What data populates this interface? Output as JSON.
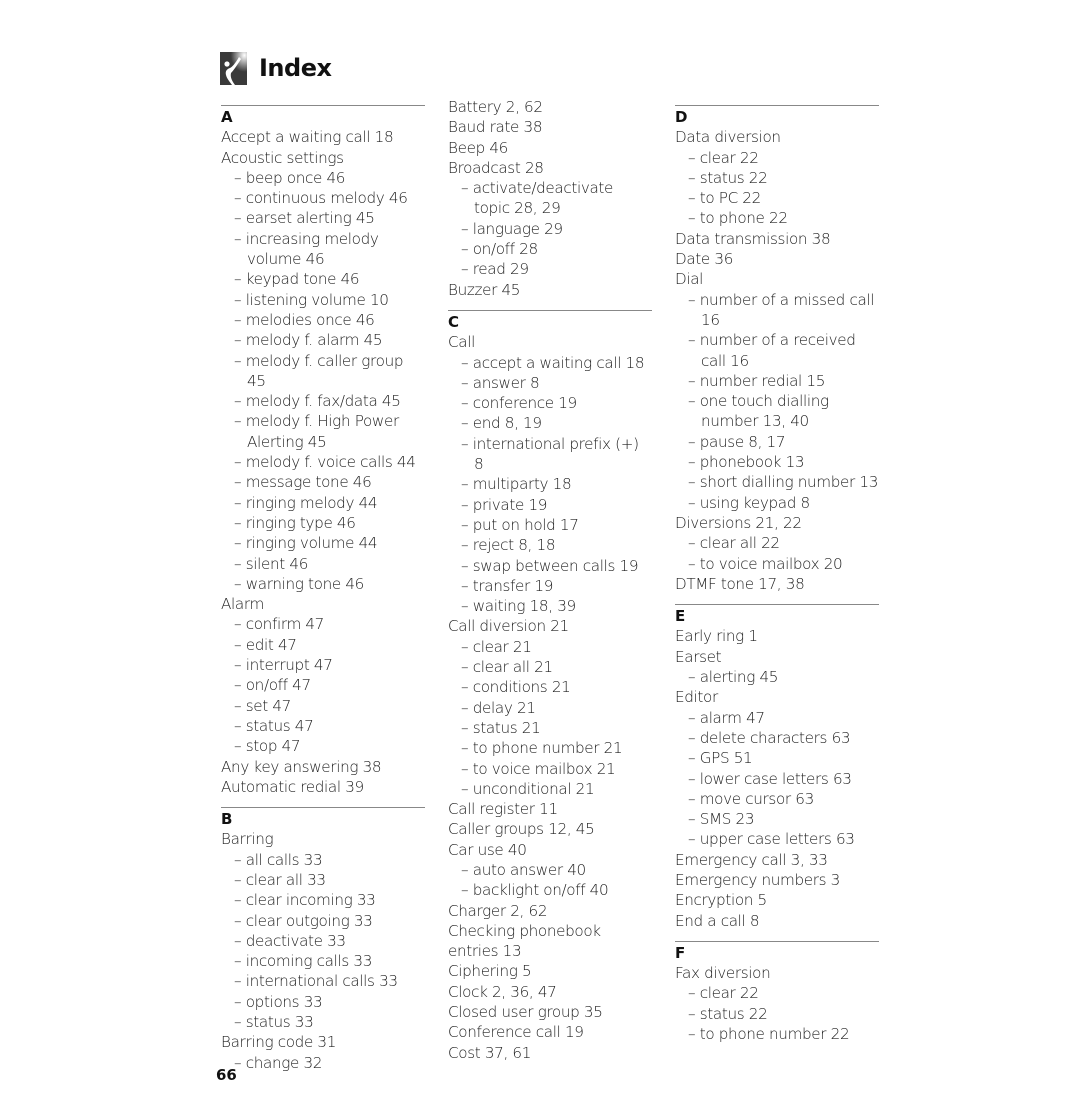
{
  "header": {
    "title": "Index",
    "icon": "person-with-raised-arm-logo"
  },
  "page_number": "66",
  "columns": [
    {
      "sections": [
        {
          "letter": "A",
          "separator": true,
          "entries": [
            {
              "text": "Accept a waiting call 18",
              "level": 0
            },
            {
              "text": "Acoustic settings",
              "level": 0
            },
            {
              "text": "beep once 46",
              "level": 1
            },
            {
              "text": "continuous melody 46",
              "level": 1
            },
            {
              "text": "earset alerting 45",
              "level": 1
            },
            {
              "text": "increasing melody volume 46",
              "level": 1
            },
            {
              "text": "keypad tone 46",
              "level": 1
            },
            {
              "text": "listening volume 10",
              "level": 1
            },
            {
              "text": "melodies once 46",
              "level": 1
            },
            {
              "text": "melody f. alarm 45",
              "level": 1
            },
            {
              "text": "melody f. caller group 45",
              "level": 1
            },
            {
              "text": "melody f. fax/data 45",
              "level": 1
            },
            {
              "text": "melody f. High Power Alerting 45",
              "level": 1
            },
            {
              "text": "melody f. voice calls 44",
              "level": 1
            },
            {
              "text": "message tone 46",
              "level": 1
            },
            {
              "text": "ringing melody 44",
              "level": 1
            },
            {
              "text": "ringing type 46",
              "level": 1
            },
            {
              "text": "ringing volume 44",
              "level": 1
            },
            {
              "text": "silent 46",
              "level": 1
            },
            {
              "text": "warning tone 46",
              "level": 1
            },
            {
              "text": "Alarm",
              "level": 0
            },
            {
              "text": "confirm 47",
              "level": 1
            },
            {
              "text": "edit 47",
              "level": 1
            },
            {
              "text": "interrupt 47",
              "level": 1
            },
            {
              "text": "on/off 47",
              "level": 1
            },
            {
              "text": "set 47",
              "level": 1
            },
            {
              "text": "status 47",
              "level": 1
            },
            {
              "text": "stop 47",
              "level": 1
            },
            {
              "text": "Any key answering 38",
              "level": 0
            },
            {
              "text": "Automatic redial 39",
              "level": 0
            }
          ]
        },
        {
          "letter": "B",
          "separator": true,
          "entries": [
            {
              "text": "Barring",
              "level": 0
            },
            {
              "text": "all calls 33",
              "level": 1
            },
            {
              "text": "clear all 33",
              "level": 1
            },
            {
              "text": "clear incoming 33",
              "level": 1
            },
            {
              "text": "clear outgoing 33",
              "level": 1
            },
            {
              "text": "deactivate 33",
              "level": 1
            },
            {
              "text": "incoming calls 33",
              "level": 1
            },
            {
              "text": "international calls 33",
              "level": 1
            },
            {
              "text": "options 33",
              "level": 1
            },
            {
              "text": "status 33",
              "level": 1
            },
            {
              "text": "Barring code 31",
              "level": 0
            },
            {
              "text": "change 32",
              "level": 1
            }
          ]
        }
      ]
    },
    {
      "sections": [
        {
          "letter": "",
          "separator": false,
          "entries": [
            {
              "text": "Battery 2, 62",
              "level": 0
            },
            {
              "text": "Baud rate 38",
              "level": 0
            },
            {
              "text": "Beep 46",
              "level": 0
            },
            {
              "text": "Broadcast 28",
              "level": 0
            },
            {
              "text": "activate/deactivate topic 28, 29",
              "level": 1
            },
            {
              "text": "language 29",
              "level": 1
            },
            {
              "text": "on/off 28",
              "level": 1
            },
            {
              "text": "read 29",
              "level": 1
            },
            {
              "text": "Buzzer 45",
              "level": 0
            }
          ]
        },
        {
          "letter": "C",
          "separator": true,
          "entries": [
            {
              "text": "Call",
              "level": 0
            },
            {
              "text": "accept a waiting call 18",
              "level": 1
            },
            {
              "text": "answer 8",
              "level": 1
            },
            {
              "text": "conference 19",
              "level": 1
            },
            {
              "text": "end 8, 19",
              "level": 1
            },
            {
              "text": "international prefix (+) 8",
              "level": 1
            },
            {
              "text": "multiparty 18",
              "level": 1
            },
            {
              "text": "private 19",
              "level": 1
            },
            {
              "text": "put on hold 17",
              "level": 1
            },
            {
              "text": "reject 8, 18",
              "level": 1
            },
            {
              "text": "swap between calls 19",
              "level": 1
            },
            {
              "text": "transfer 19",
              "level": 1
            },
            {
              "text": "waiting 18, 39",
              "level": 1
            },
            {
              "text": "Call diversion 21",
              "level": 0
            },
            {
              "text": "clear 21",
              "level": 1
            },
            {
              "text": "clear all 21",
              "level": 1
            },
            {
              "text": "conditions 21",
              "level": 1
            },
            {
              "text": "delay 21",
              "level": 1
            },
            {
              "text": "status 21",
              "level": 1
            },
            {
              "text": "to phone number 21",
              "level": 1
            },
            {
              "text": "to voice mailbox 21",
              "level": 1
            },
            {
              "text": "unconditional 21",
              "level": 1
            },
            {
              "text": "Call register 11",
              "level": 0
            },
            {
              "text": "Caller groups 12, 45",
              "level": 0
            },
            {
              "text": "Car use 40",
              "level": 0
            },
            {
              "text": "auto answer 40",
              "level": 1
            },
            {
              "text": "backlight on/off 40",
              "level": 1
            },
            {
              "text": "Charger 2, 62",
              "level": 0
            },
            {
              "text": "Checking phonebook entries 13",
              "level": 0
            },
            {
              "text": "Ciphering 5",
              "level": 0
            },
            {
              "text": "Clock 2, 36, 47",
              "level": 0
            },
            {
              "text": "Closed user group 35",
              "level": 0
            },
            {
              "text": "Conference call 19",
              "level": 0
            },
            {
              "text": "Cost 37, 61",
              "level": 0
            }
          ]
        }
      ]
    },
    {
      "sections": [
        {
          "letter": "D",
          "separator": true,
          "entries": [
            {
              "text": "Data diversion",
              "level": 0
            },
            {
              "text": "clear 22",
              "level": 1
            },
            {
              "text": "status 22",
              "level": 1
            },
            {
              "text": "to PC 22",
              "level": 1
            },
            {
              "text": "to phone 22",
              "level": 1
            },
            {
              "text": "Data transmission 38",
              "level": 0
            },
            {
              "text": "Date 36",
              "level": 0
            },
            {
              "text": "Dial",
              "level": 0
            },
            {
              "text": "number of a missed call 16",
              "level": 1
            },
            {
              "text": "number of a received call 16",
              "level": 1
            },
            {
              "text": "number redial 15",
              "level": 1
            },
            {
              "text": "one touch dialling number 13, 40",
              "level": 1
            },
            {
              "text": "pause 8, 17",
              "level": 1
            },
            {
              "text": "phonebook 13",
              "level": 1
            },
            {
              "text": "short dialling number 13",
              "level": 1
            },
            {
              "text": "using keypad 8",
              "level": 1
            },
            {
              "text": "Diversions 21, 22",
              "level": 0
            },
            {
              "text": "clear all 22",
              "level": 1
            },
            {
              "text": "to voice mailbox 20",
              "level": 1
            },
            {
              "text": "DTMF tone 17, 38",
              "level": 0
            }
          ]
        },
        {
          "letter": "E",
          "separator": true,
          "entries": [
            {
              "text": "Early ring 1",
              "level": 0
            },
            {
              "text": "Earset",
              "level": 0
            },
            {
              "text": "alerting 45",
              "level": 1
            },
            {
              "text": "Editor",
              "level": 0
            },
            {
              "text": "alarm 47",
              "level": 1
            },
            {
              "text": "delete characters 63",
              "level": 1
            },
            {
              "text": "GPS 51",
              "level": 1
            },
            {
              "text": "lower case letters 63",
              "level": 1
            },
            {
              "text": "move cursor 63",
              "level": 1
            },
            {
              "text": "SMS 23",
              "level": 1
            },
            {
              "text": "upper case letters 63",
              "level": 1
            },
            {
              "text": "Emergency call 3, 33",
              "level": 0
            },
            {
              "text": "Emergency numbers 3",
              "level": 0
            },
            {
              "text": "Encryption 5",
              "level": 0
            },
            {
              "text": "End a call 8",
              "level": 0
            }
          ]
        },
        {
          "letter": "F",
          "separator": true,
          "entries": [
            {
              "text": "Fax diversion",
              "level": 0
            },
            {
              "text": "clear 22",
              "level": 1
            },
            {
              "text": "status 22",
              "level": 1
            },
            {
              "text": "to phone number 22",
              "level": 1
            }
          ]
        }
      ]
    }
  ]
}
